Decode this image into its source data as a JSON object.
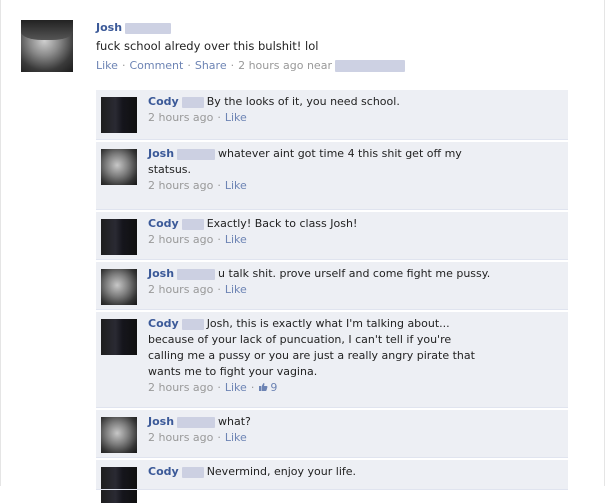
{
  "post": {
    "author": "Josh",
    "text": "fuck school alredy over this bulshit! lol",
    "actions": {
      "like": "Like",
      "comment": "Comment",
      "share": "Share",
      "time": "2 hours ago near"
    }
  },
  "comments": [
    {
      "author": "Cody",
      "avatar": "cody",
      "lines": [
        "By the looks of it, you need school."
      ],
      "time": "2 hours ago",
      "like": "Like"
    },
    {
      "author": "Josh",
      "avatar": "josh",
      "lines": [
        "whatever aint got time 4 this shit get off my",
        "statsus."
      ],
      "time": "2 hours ago",
      "like": "Like"
    },
    {
      "author": "Cody",
      "avatar": "cody",
      "lines": [
        "Exactly! Back to class Josh!"
      ],
      "time": "2 hours ago",
      "like": "Like"
    },
    {
      "author": "Josh",
      "avatar": "josh",
      "lines": [
        "u talk shit. prove urself and come fight me pussy."
      ],
      "time": "2 hours ago",
      "like": "Like"
    },
    {
      "author": "Cody",
      "avatar": "cody",
      "lines": [
        "Josh, this is exactly what I'm talking about...",
        "because of your lack of puncuation, I can't tell if you're",
        "calling me a pussy or you are just a really angry pirate that",
        "wants me to fight your vagina."
      ],
      "time": "2 hours ago",
      "like": "Like",
      "like_count": "9"
    },
    {
      "author": "Josh",
      "avatar": "josh",
      "lines": [
        "what?"
      ],
      "time": "2 hours ago",
      "like": "Like"
    },
    {
      "author": "Cody",
      "avatar": "cody",
      "lines": [
        "Nevermind, enjoy your life."
      ],
      "time": "",
      "like": ""
    }
  ]
}
